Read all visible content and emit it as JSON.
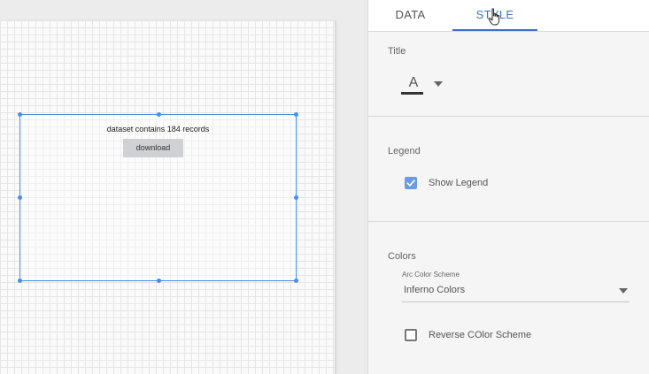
{
  "canvas": {
    "record_text": "dataset contains 184 records",
    "download_label": "download"
  },
  "tabs": [
    {
      "label": "DATA",
      "active": false
    },
    {
      "label": "STYLE",
      "active": true
    }
  ],
  "sections": {
    "title": {
      "heading": "Title",
      "font_color_letter": "A",
      "font_color": "#333333"
    },
    "legend": {
      "heading": "Legend",
      "show_legend_label": "Show Legend",
      "show_legend_checked": true
    },
    "colors": {
      "heading": "Colors",
      "scheme_caption": "Arc Color Scheme",
      "scheme_value": "Inferno Colors",
      "reverse_label": "Reverse COlor Scheme",
      "reverse_checked": false
    }
  },
  "theme": {
    "accent": "#3b6fd0",
    "selection": "#4a90e2",
    "checkbox_fill": "#6b9be5"
  },
  "icons": {
    "cursor": "hand-pointer-icon",
    "check": "checkmark-icon",
    "dropdown": "chevron-down-icon"
  }
}
